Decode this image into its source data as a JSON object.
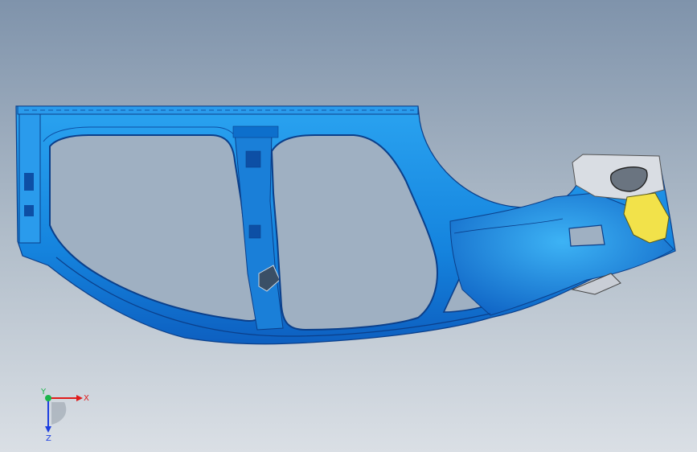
{
  "viewport": {
    "background_top": "#7f93ab",
    "background_bottom": "#dadfe5"
  },
  "model": {
    "part_color": "#1a8fe6",
    "outline_color": "#0b3f8a",
    "highlight_color": "#f2e24a",
    "bracket_color": "#d9dde3"
  },
  "triad": {
    "x_label": "X",
    "y_label": "Y",
    "z_label": "Z",
    "x_color": "#e01b1b",
    "y_color": "#1bb54b",
    "z_color": "#1b3ee0"
  }
}
